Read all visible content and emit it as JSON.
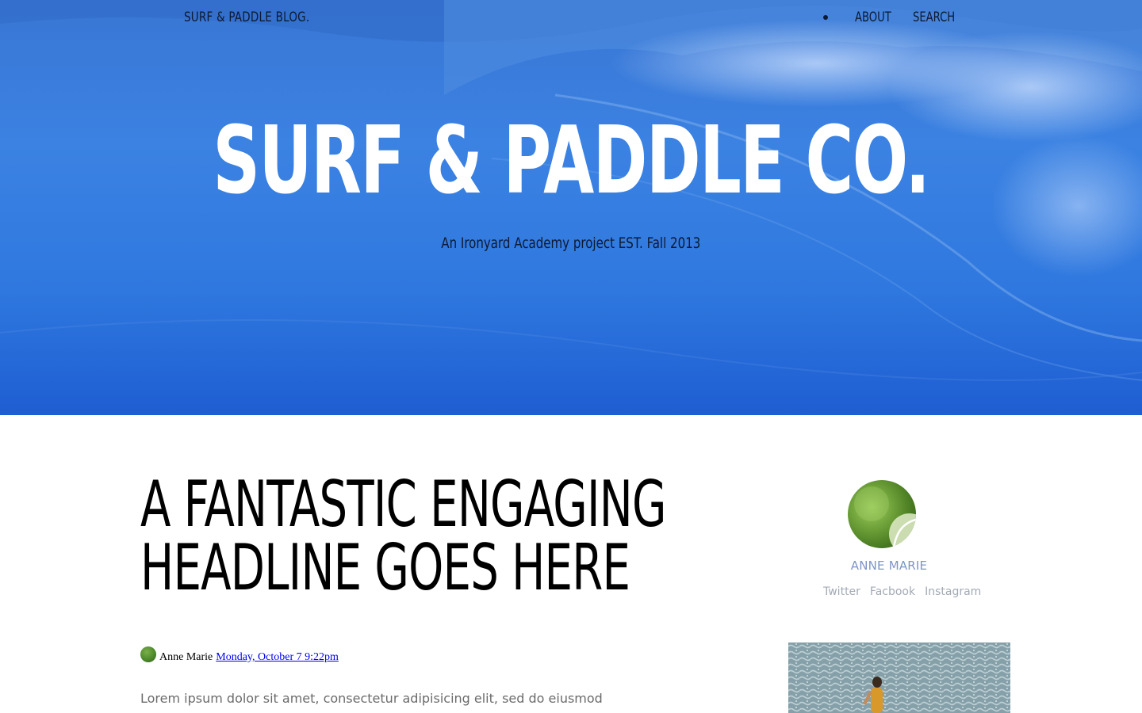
{
  "header": {
    "brand": "SURF & PADDLE BLOG.",
    "nav": [
      {
        "label": "ABOUT"
      },
      {
        "label": "SEARCH"
      }
    ]
  },
  "hero": {
    "title": "SURF & PADDLE CO.",
    "subtitle": "An Ironyard Academy project EST. Fall 2013",
    "background": "ocean-wave-image"
  },
  "article": {
    "headline": "A FANTASTIC ENGAGING HEADLINE GOES HERE",
    "author": "Anne Marie",
    "date_link": "Monday, October 7 9:22pm",
    "excerpt": "Lorem ipsum dolor sit amet, consectetur adipisicing elit, sed do eiusmod"
  },
  "sidebar": {
    "author_name": "ANNE MARIE",
    "social": [
      {
        "label": "Twitter"
      },
      {
        "label": "Facbook"
      },
      {
        "label": "Instagram"
      }
    ]
  },
  "colors": {
    "hero_blue": "#2e7ae0",
    "dark_text": "#0c1a33",
    "author_accent": "#7d95c7",
    "muted_link": "#a3aab5"
  }
}
